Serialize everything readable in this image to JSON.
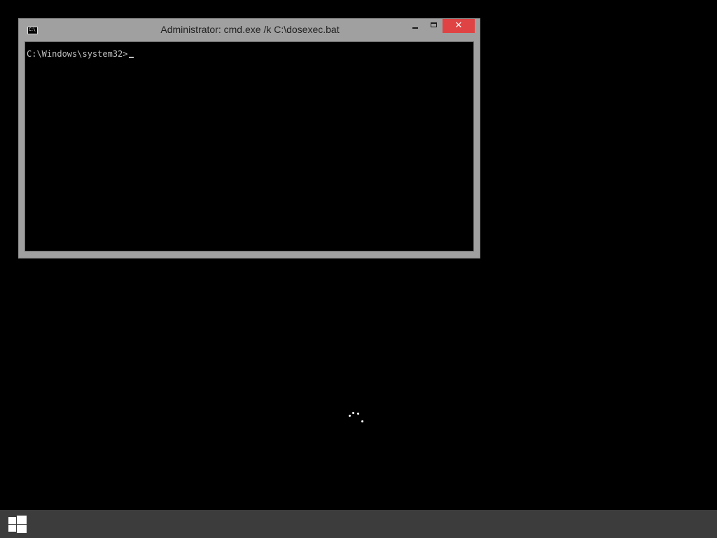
{
  "window": {
    "title": "Administrator: cmd.exe /k C:\\dosexec.bat",
    "icon": "cmd-icon",
    "icon_text": "C:\\",
    "controls": {
      "minimize": "minimize-icon",
      "maximize": "maximize-icon",
      "close_label": "✕"
    },
    "close_color": "#e04343",
    "frame_color": "#a0a0a0"
  },
  "console": {
    "prompt": "C:\\Windows\\system32>",
    "text_color": "#c0c0c0",
    "background": "#000000"
  },
  "desktop": {
    "background": "#000000",
    "spinner": "loading-spinner-icon"
  },
  "taskbar": {
    "background": "#3c3c3c",
    "start_icon": "windows-logo-icon"
  }
}
